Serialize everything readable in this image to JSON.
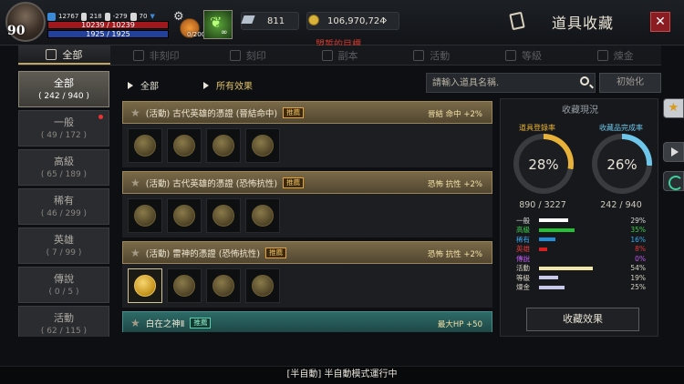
{
  "player": {
    "level": "90",
    "stat1": "12767",
    "stat2": "218",
    "stat3": "-279",
    "stat4": "70",
    "hp": "10239 / 10239",
    "mp": "1925 / 1925",
    "potion_count": "0/200",
    "buff_duration": "∞"
  },
  "currency": {
    "crystal": "811",
    "gold": "106,970,724"
  },
  "goal_text": "盟誓的目標",
  "window_title": "道具收藏",
  "tabs": [
    {
      "label": "全部",
      "icon": "book-icon"
    },
    {
      "label": "非刻印",
      "icon": "shield-icon"
    },
    {
      "label": "刻印",
      "icon": "shield-icon"
    },
    {
      "label": "副本",
      "icon": "horseshoe-icon"
    },
    {
      "label": "活動",
      "icon": "flag-icon"
    },
    {
      "label": "等級",
      "icon": "shield-icon"
    },
    {
      "label": "煉金",
      "icon": "flower-icon"
    }
  ],
  "grades": [
    {
      "name": "全部",
      "count": "( 242 / 940 )"
    },
    {
      "name": "一般",
      "count": "( 49 / 172 )"
    },
    {
      "name": "高級",
      "count": "( 65 / 189 )"
    },
    {
      "name": "稀有",
      "count": "( 46 / 299 )"
    },
    {
      "name": "英雄",
      "count": "( 7 / 99 )"
    },
    {
      "name": "傳說",
      "count": "( 0 / 5 )"
    },
    {
      "name": "活動",
      "count": "( 62 / 115 )"
    }
  ],
  "filter": {
    "category": "全部",
    "effect": "所有效果",
    "search_placeholder": "請輸入道具名稱.",
    "reset_label": "初始化"
  },
  "groups": [
    {
      "title": "(活動) 古代英雄的憑證 (晉結命中)",
      "tag": "推薦",
      "effect": "晉結 命中 +2%",
      "slots": [
        false,
        false,
        false,
        false
      ]
    },
    {
      "title": "(活動) 古代英雄的憑證 (恐怖抗性)",
      "tag": "推薦",
      "effect": "恐怖 抗性 +2%",
      "slots": [
        false,
        false,
        false,
        false
      ]
    },
    {
      "title": "(活動) 雷神的憑證 (恐怖抗性)",
      "tag": "推薦",
      "effect": "恐怖 抗性 +2%",
      "slots": [
        true,
        false,
        false,
        false
      ]
    },
    {
      "title": "白在之神Ⅱ",
      "tag": "推薦",
      "effect": "最大HP +50",
      "slots": [
        false,
        false,
        false,
        false
      ]
    }
  ],
  "stats": {
    "title": "收藏現況",
    "registration_label": "道具登錄率",
    "completion_label": "收藏品完成率",
    "registration_pct": "28%",
    "completion_pct": "26%",
    "registration_count": "890 / 3227",
    "completion_count": "242 / 940",
    "rows": [
      {
        "label": "一般",
        "value": 0.29,
        "pct": "29%",
        "color": "#ffffff",
        "label_color": "#d8d8d8"
      },
      {
        "label": "高級",
        "value": 0.35,
        "pct": "35%",
        "color": "#22c236",
        "label_color": "#3ad04a"
      },
      {
        "label": "稀有",
        "value": 0.16,
        "pct": "16%",
        "color": "#1f8fdc",
        "label_color": "#3aa8ea"
      },
      {
        "label": "英雄",
        "value": 0.08,
        "pct": "8%",
        "color": "#d81f1f",
        "label_color": "#e03a3a"
      },
      {
        "label": "傳說",
        "value": 0.0,
        "pct": "0%",
        "color": "#b04adf",
        "label_color": "#c05aef"
      },
      {
        "label": "活動",
        "value": 0.54,
        "pct": "54%",
        "color": "#f0e6a8",
        "label_color": "#d8d4c4"
      },
      {
        "label": "等級",
        "value": 0.19,
        "pct": "19%",
        "color": "#c8c8ea",
        "label_color": "#d8d4c4"
      },
      {
        "label": "煉金",
        "value": 0.25,
        "pct": "25%",
        "color": "#c8c8ea",
        "label_color": "#d8d4c4"
      }
    ],
    "effect_button": "收藏效果"
  },
  "status_text": "[半自動] 半自動模式運行中"
}
